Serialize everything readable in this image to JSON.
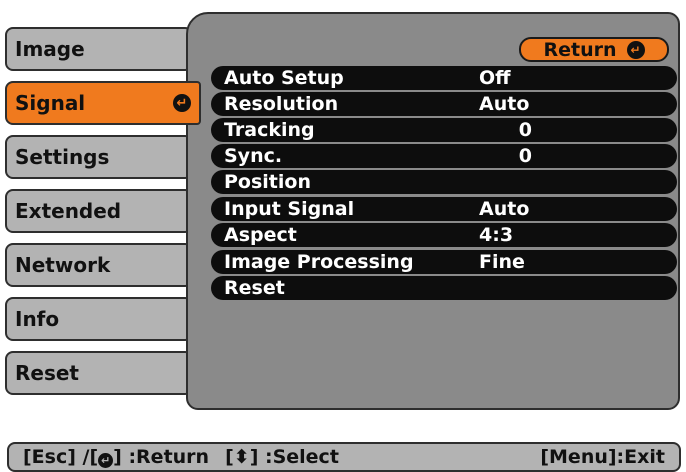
{
  "menu": {
    "items": [
      {
        "label": "Image"
      },
      {
        "label": "Signal",
        "selected": true
      },
      {
        "label": "Settings"
      },
      {
        "label": "Extended"
      },
      {
        "label": "Network"
      },
      {
        "label": "Info"
      },
      {
        "label": "Reset"
      }
    ],
    "selected_icon": "enter-icon"
  },
  "panel": {
    "return_label": "Return",
    "rows": [
      {
        "label": "Auto Setup",
        "value": "Off"
      },
      {
        "label": "Resolution",
        "value": "Auto"
      },
      {
        "label": "Tracking",
        "value": "0"
      },
      {
        "label": "Sync.",
        "value": "0"
      },
      {
        "label": "Position",
        "value": ""
      },
      {
        "label": "Input Signal",
        "value": "Auto"
      },
      {
        "label": "Aspect",
        "value": "4:3"
      },
      {
        "label": "Image Processing",
        "value": "Fine"
      },
      {
        "label": "Reset",
        "value": ""
      }
    ]
  },
  "help": {
    "esc_part": "[Esc] /[",
    "return_part": "] :Return",
    "select_part": "[",
    "select_tail": "] :Select",
    "exit": "[Menu]:Exit"
  },
  "colors": {
    "accent": "#f07a1e",
    "panel": "#8a8a8a",
    "menu": "#b3b3b3",
    "row": "#0d0d0d"
  }
}
